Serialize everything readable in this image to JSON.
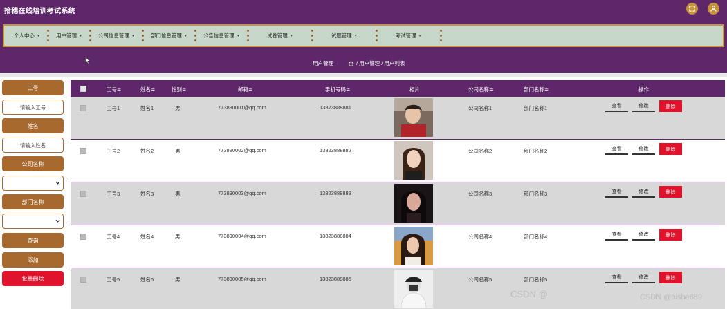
{
  "app": {
    "title": "拾穗在线培训考试系统"
  },
  "header_icons": [
    "fullscreen-icon",
    "user-icon"
  ],
  "nav": {
    "items": [
      {
        "label": "个人中心"
      },
      {
        "label": "用户管理"
      },
      {
        "label": "公司信息管理"
      },
      {
        "label": "部门信息管理"
      },
      {
        "label": "公告信息管理"
      },
      {
        "label": "试卷管理"
      },
      {
        "label": "试题管理"
      },
      {
        "label": "考试管理"
      }
    ]
  },
  "breadcrumb": {
    "title": "用户管理",
    "path": "/ 用户管理 / 用户列表"
  },
  "sidebar": {
    "employee_no_label": "工号",
    "employee_no_placeholder": "请输入工号",
    "name_label": "姓名",
    "name_placeholder": "请输入姓名",
    "company_label": "公司名称",
    "department_label": "部门名称",
    "query_button": "查询",
    "add_button": "添加",
    "batch_delete_button": "批量删除"
  },
  "table": {
    "headers": {
      "employee_no": "工号",
      "name": "姓名",
      "gender": "性别",
      "email": "邮箱",
      "phone": "手机号码",
      "photo": "相片",
      "company": "公司名称",
      "department": "部门名称",
      "actions": "操作"
    },
    "sort_glyph": "≑",
    "rows": [
      {
        "employee_no": "工号1",
        "name": "姓名1",
        "gender": "男",
        "email": "773890001@qq.com",
        "phone": "13823888881",
        "company": "公司名称1",
        "department": "部门名称1"
      },
      {
        "employee_no": "工号2",
        "name": "姓名2",
        "gender": "男",
        "email": "773890002@qq.com",
        "phone": "13823888882",
        "company": "公司名称2",
        "department": "部门名称2"
      },
      {
        "employee_no": "工号3",
        "name": "姓名3",
        "gender": "男",
        "email": "773890003@qq.com",
        "phone": "13823888883",
        "company": "公司名称3",
        "department": "部门名称3"
      },
      {
        "employee_no": "工号4",
        "name": "姓名4",
        "gender": "男",
        "email": "773890004@qq.com",
        "phone": "13823888884",
        "company": "公司名称4",
        "department": "部门名称4"
      },
      {
        "employee_no": "工号5",
        "name": "姓名5",
        "gender": "男",
        "email": "773890005@qq.com",
        "phone": "13823888885",
        "company": "公司名称5",
        "department": "部门名称5"
      }
    ],
    "actions": {
      "view": "查看",
      "edit": "修改",
      "delete": "删除"
    }
  },
  "watermark": {
    "left": "CSDN @",
    "right": "CSDN @bishe689"
  },
  "colors": {
    "header": "#5d2769",
    "accent": "#a8692e",
    "nav_bg": "#c7d7c9",
    "danger": "#e0122c"
  }
}
